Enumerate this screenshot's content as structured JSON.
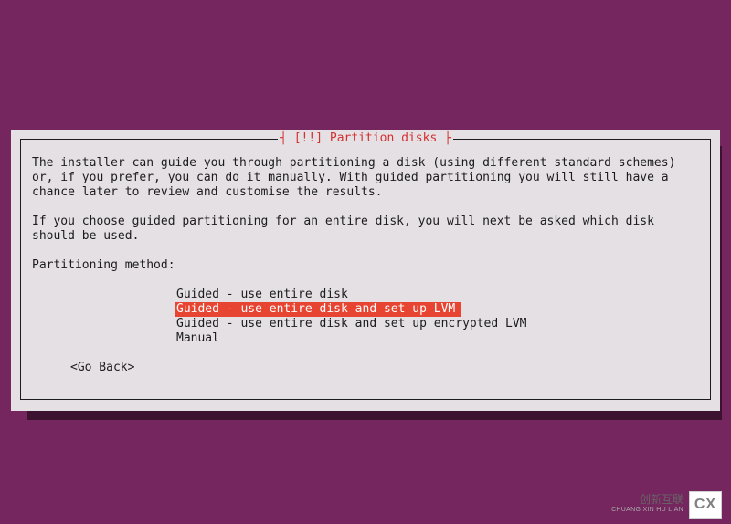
{
  "dialog": {
    "title": "┤ [!!] Partition disks ├",
    "para1": "The installer can guide you through partitioning a disk (using different standard schemes) or, if you prefer, you can do it manually. With guided partitioning you will still have a chance later to review and customise the results.",
    "para2": "If you choose guided partitioning for an entire disk, you will next be asked which disk should be used.",
    "prompt": "Partitioning method:",
    "options": [
      "Guided - use entire disk",
      "Guided - use entire disk and set up LVM",
      "Guided - use entire disk and set up encrypted LVM",
      "Manual"
    ],
    "selected_index": 1,
    "go_back": "<Go Back>"
  },
  "watermark": {
    "logo": "CX",
    "line1": "创新互联",
    "line2": "CHUANG XIN HU LIAN"
  }
}
